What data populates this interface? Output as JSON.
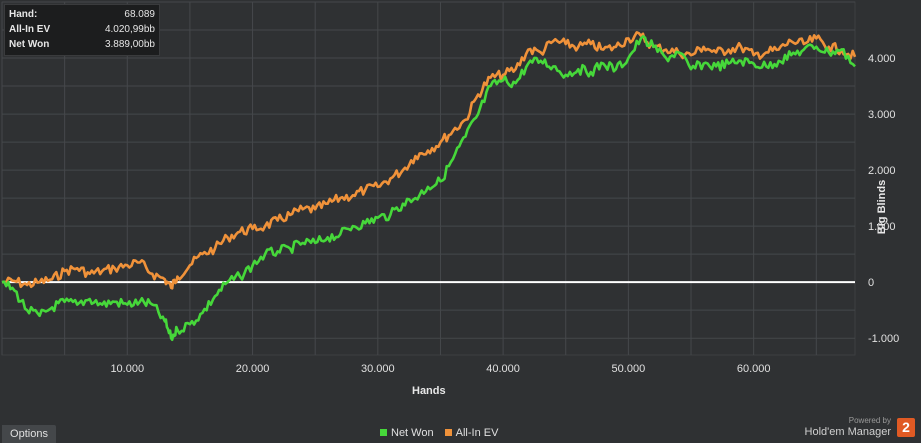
{
  "tooltip": {
    "hand_label": "Hand:",
    "hand_value": "68.089",
    "ev_label": "All-In EV",
    "ev_value": "4.020,99bb",
    "won_label": "Net Won",
    "won_value": "3.889,00bb"
  },
  "options_label": "Options",
  "brand": {
    "powered": "Powered by",
    "name": "Hold'em Manager",
    "logo_text": "2"
  },
  "colors": {
    "net_won": "#46d83a",
    "all_in_ev": "#f0923a",
    "grid": "#45484b",
    "zero_line": "#ffffff",
    "background": "#2f3133"
  },
  "chart_data": {
    "type": "line",
    "xlabel": "Hands",
    "ylabel": "Big Blinds",
    "xlim": [
      0,
      68089
    ],
    "ylim": [
      -1300,
      5000
    ],
    "x_ticks": [
      10000,
      20000,
      30000,
      40000,
      50000,
      60000
    ],
    "x_tick_labels": [
      "10.000",
      "20.000",
      "30.000",
      "40.000",
      "50.000",
      "60.000"
    ],
    "y_ticks": [
      -1000,
      0,
      1000,
      2000,
      3000,
      4000
    ],
    "y_tick_labels": [
      "-1.000",
      "0",
      "1.000",
      "2.000",
      "3.000",
      "4.000"
    ],
    "y_axis_side": "right",
    "grid": true,
    "legend_position": "bottom-center",
    "series": [
      {
        "name": "Net Won",
        "x": [
          0,
          1000,
          2000,
          3000,
          4000,
          5000,
          6000,
          7000,
          8000,
          9000,
          10000,
          11000,
          12000,
          13000,
          13500,
          14000,
          15000,
          16000,
          17000,
          18000,
          19000,
          20000,
          21000,
          22000,
          23000,
          24000,
          25000,
          26000,
          27000,
          28000,
          29000,
          30000,
          31000,
          32000,
          33000,
          34000,
          35000,
          36000,
          37000,
          38000,
          39000,
          40000,
          41000,
          42000,
          43000,
          44000,
          45000,
          46000,
          47000,
          48000,
          49000,
          50000,
          51000,
          52000,
          53000,
          54000,
          55000,
          56000,
          57000,
          58000,
          59000,
          60000,
          61000,
          62000,
          63000,
          64000,
          65000,
          66000,
          67000,
          68089
        ],
        "values": [
          0,
          -150,
          -500,
          -600,
          -450,
          -350,
          -400,
          -300,
          -400,
          -350,
          -400,
          -350,
          -400,
          -700,
          -1000,
          -850,
          -750,
          -550,
          -250,
          0,
          100,
          300,
          500,
          550,
          600,
          700,
          700,
          800,
          850,
          1000,
          1050,
          1150,
          1200,
          1400,
          1500,
          1700,
          1800,
          2200,
          2600,
          3000,
          3500,
          3600,
          3550,
          3900,
          3950,
          3850,
          3700,
          3800,
          3750,
          3900,
          3800,
          4000,
          4350,
          4200,
          4000,
          4100,
          3800,
          3900,
          3850,
          3900,
          3950,
          3900,
          3850,
          3950,
          4050,
          4150,
          4200,
          4100,
          4150,
          3850
        ]
      },
      {
        "name": "All-In EV",
        "x": [
          0,
          1000,
          2000,
          3000,
          4000,
          5000,
          6000,
          7000,
          8000,
          9000,
          10000,
          11000,
          12000,
          13000,
          13500,
          14000,
          15000,
          16000,
          17000,
          18000,
          19000,
          20000,
          21000,
          22000,
          23000,
          24000,
          25000,
          26000,
          27000,
          28000,
          29000,
          30000,
          31000,
          32000,
          33000,
          34000,
          35000,
          36000,
          37000,
          38000,
          39000,
          40000,
          41000,
          42000,
          43000,
          44000,
          45000,
          46000,
          47000,
          48000,
          49000,
          50000,
          51000,
          52000,
          53000,
          54000,
          55000,
          56000,
          57000,
          58000,
          59000,
          60000,
          61000,
          62000,
          63000,
          64000,
          65000,
          66000,
          67000,
          68089
        ],
        "values": [
          0,
          20,
          -50,
          0,
          50,
          200,
          250,
          150,
          200,
          250,
          300,
          350,
          150,
          50,
          -100,
          100,
          300,
          500,
          600,
          800,
          900,
          950,
          1000,
          1100,
          1200,
          1300,
          1300,
          1400,
          1500,
          1550,
          1650,
          1700,
          1850,
          2000,
          2250,
          2350,
          2500,
          2700,
          2900,
          3350,
          3650,
          3700,
          3800,
          4150,
          4100,
          4300,
          4250,
          4200,
          4250,
          4150,
          4200,
          4350,
          4400,
          4200,
          4150,
          4100,
          4050,
          4200,
          4100,
          4150,
          4200,
          4050,
          4100,
          4150,
          4300,
          4250,
          4350,
          4200,
          4150,
          4020
        ]
      }
    ]
  }
}
